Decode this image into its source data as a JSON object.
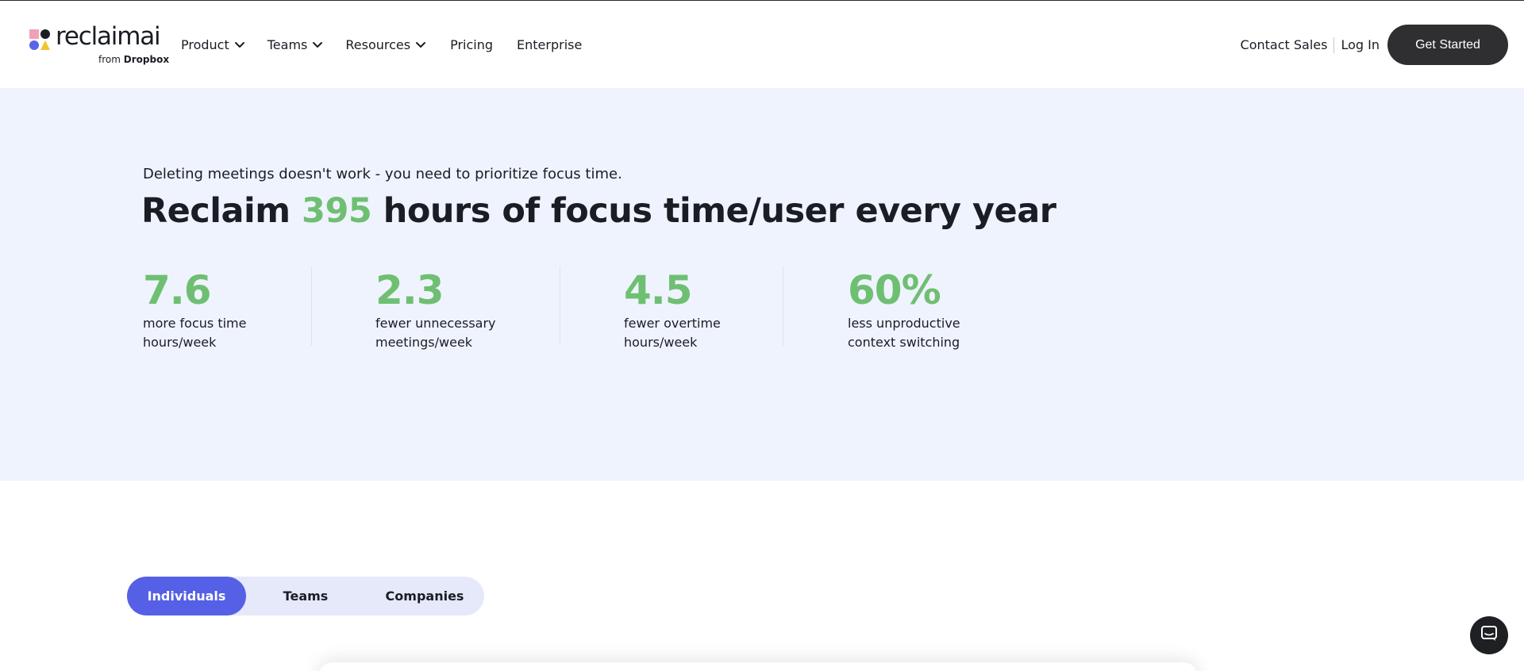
{
  "brand": {
    "name": "reclaimai",
    "sub_prefix": "from",
    "sub_brand": "Dropbox",
    "colors": {
      "accent_green": "#6fbf73",
      "accent_blue": "#5560e6",
      "dark": "#2f2f31",
      "hero_bg": "#eff3fd"
    }
  },
  "nav": {
    "items": [
      {
        "label": "Product",
        "has_dropdown": true
      },
      {
        "label": "Teams",
        "has_dropdown": true
      },
      {
        "label": "Resources",
        "has_dropdown": true
      },
      {
        "label": "Pricing",
        "has_dropdown": false
      },
      {
        "label": "Enterprise",
        "has_dropdown": false
      }
    ],
    "contact_sales": "Contact Sales",
    "login": "Log In",
    "cta": "Get Started"
  },
  "hero": {
    "subtitle": "Deleting meetings doesn't work - you need to prioritize focus time.",
    "title_prefix": "Reclaim ",
    "title_number": "395",
    "title_suffix": " hours of focus time/user every year",
    "stats": [
      {
        "value": "7.6",
        "label": "more focus time hours/week"
      },
      {
        "value": "2.3",
        "label": "fewer unnecessary meetings/week"
      },
      {
        "value": "4.5",
        "label": "fewer overtime hours/week"
      },
      {
        "value": "60%",
        "label": "less unproductive context switching"
      }
    ]
  },
  "tabs": {
    "items": [
      "Individuals",
      "Teams",
      "Companies"
    ],
    "active": "Individuals"
  },
  "icons": {
    "chat": "chat-bubble-icon",
    "chevron": "chevron-down-icon"
  }
}
